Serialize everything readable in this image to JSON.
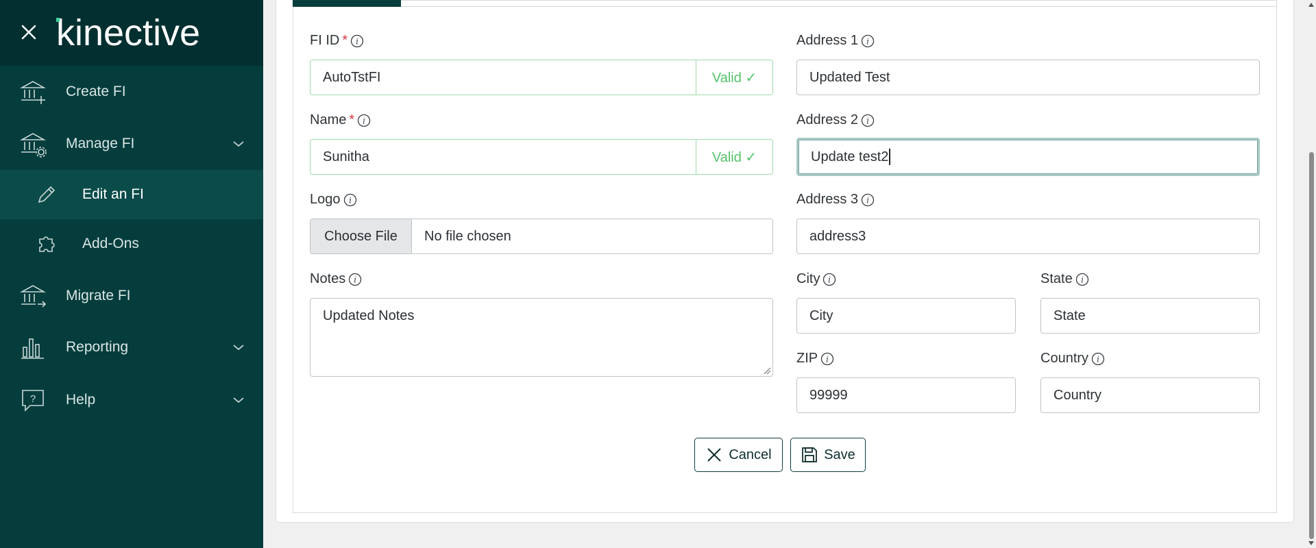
{
  "brand": {
    "logo_text": "kinective"
  },
  "sidebar": {
    "items": [
      {
        "label": "Create FI",
        "icon": "bank-plus-icon"
      },
      {
        "label": "Manage FI",
        "icon": "bank-gear-icon",
        "expandable": true
      },
      {
        "label": "Edit an FI",
        "icon": "pencil-icon",
        "sub": true,
        "active": true
      },
      {
        "label": "Add-Ons",
        "icon": "puzzle-icon",
        "sub": true
      },
      {
        "label": "Migrate FI",
        "icon": "bank-arrow-icon"
      },
      {
        "label": "Reporting",
        "icon": "bar-chart-icon",
        "expandable": true
      },
      {
        "label": "Help",
        "icon": "help-bubble-icon",
        "expandable": true
      }
    ]
  },
  "form": {
    "fi_id": {
      "label": "FI ID",
      "required": "*",
      "value": "AutoTstFI",
      "status": "Valid ✓"
    },
    "name": {
      "label": "Name",
      "required": "*",
      "value": "Sunitha",
      "status": "Valid ✓"
    },
    "logo": {
      "label": "Logo",
      "button": "Choose File",
      "file_name": "No file chosen"
    },
    "notes": {
      "label": "Notes",
      "value": "Updated Notes"
    },
    "address1": {
      "label": "Address 1",
      "value": "Updated Test"
    },
    "address2": {
      "label": "Address 2",
      "value": "Update test2"
    },
    "address3": {
      "label": "Address 3",
      "value": "address3"
    },
    "city": {
      "label": "City",
      "value": "City"
    },
    "state": {
      "label": "State",
      "value": "State"
    },
    "zip": {
      "label": "ZIP",
      "value": "99999"
    },
    "country": {
      "label": "Country",
      "value": "Country"
    }
  },
  "actions": {
    "cancel": "Cancel",
    "save": "Save"
  },
  "colors": {
    "sidebar": "#053d3d",
    "sidebar_header": "#022f30",
    "active_item": "#0b4b4a",
    "valid": "#54c26a",
    "required": "#d6383f"
  }
}
